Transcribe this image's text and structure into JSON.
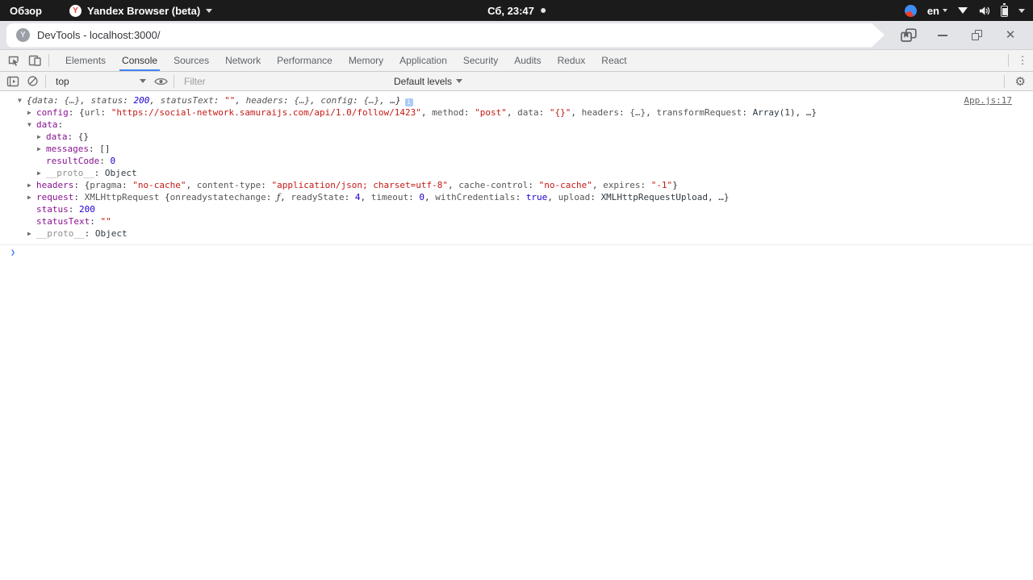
{
  "topbar": {
    "activities": "Обзор",
    "app_menu": "Yandex Browser (beta)",
    "clock": "Сб, 23:47",
    "keyboard_layout": "en"
  },
  "titlebar": {
    "title": "DevTools - localhost:3000/",
    "site_badge": "Y",
    "yandex_badge": "Y"
  },
  "devtools": {
    "tabs": [
      "Elements",
      "Console",
      "Sources",
      "Network",
      "Performance",
      "Memory",
      "Application",
      "Security",
      "Audits",
      "Redux",
      "React"
    ],
    "selected_tab": "Console",
    "console_toolbar": {
      "context": "top",
      "filter_placeholder": "Filter",
      "levels": "Default levels"
    }
  },
  "icons": {
    "gear": "⚙",
    "kebab": "⋮",
    "close": "✕",
    "info": "i"
  },
  "colors": {
    "accent_tab_underline": "#4285f4",
    "key_purple": "#881391",
    "number_blue": "#1c00cf",
    "string_red": "#c41a16",
    "topbar_bg": "#1b1b1b",
    "toolbar_bg": "#f3f3f3"
  },
  "console": {
    "prompt": "❯",
    "arrow_down": "▼",
    "arrow_right": "▶",
    "lines": [
      {
        "indent": 0,
        "arrow": "down",
        "italic": true,
        "info_icon": true,
        "link": "App.js:17",
        "tokens": [
          {
            "t": "plain",
            "v": "{"
          },
          {
            "t": "dim",
            "v": "data"
          },
          {
            "t": "plain",
            "v": ": "
          },
          {
            "t": "dim",
            "v": "{…}"
          },
          {
            "t": "plain",
            "v": ", "
          },
          {
            "t": "dim",
            "v": "status"
          },
          {
            "t": "plain",
            "v": ": "
          },
          {
            "t": "num",
            "v": "200"
          },
          {
            "t": "plain",
            "v": ", "
          },
          {
            "t": "dim",
            "v": "statusText"
          },
          {
            "t": "plain",
            "v": ": "
          },
          {
            "t": "str",
            "v": "\"\""
          },
          {
            "t": "plain",
            "v": ", "
          },
          {
            "t": "dim",
            "v": "headers"
          },
          {
            "t": "plain",
            "v": ": "
          },
          {
            "t": "dim",
            "v": "{…}"
          },
          {
            "t": "plain",
            "v": ", "
          },
          {
            "t": "dim",
            "v": "config"
          },
          {
            "t": "plain",
            "v": ": "
          },
          {
            "t": "dim",
            "v": "{…}"
          },
          {
            "t": "plain",
            "v": ", …}"
          }
        ]
      },
      {
        "indent": 1,
        "arrow": "right",
        "tokens": [
          {
            "t": "key",
            "v": "config"
          },
          {
            "t": "plain",
            "v": ": {"
          },
          {
            "t": "dim",
            "v": "url"
          },
          {
            "t": "plain",
            "v": ": "
          },
          {
            "t": "str",
            "v": "\"https://social-network.samuraijs.com/api/1.0/follow/1423\""
          },
          {
            "t": "plain",
            "v": ", "
          },
          {
            "t": "dim",
            "v": "method"
          },
          {
            "t": "plain",
            "v": ": "
          },
          {
            "t": "str",
            "v": "\"post\""
          },
          {
            "t": "plain",
            "v": ", "
          },
          {
            "t": "dim",
            "v": "data"
          },
          {
            "t": "plain",
            "v": ": "
          },
          {
            "t": "str",
            "v": "\"{}\""
          },
          {
            "t": "plain",
            "v": ", "
          },
          {
            "t": "dim",
            "v": "headers"
          },
          {
            "t": "plain",
            "v": ": "
          },
          {
            "t": "dim",
            "v": "{…}"
          },
          {
            "t": "plain",
            "v": ", "
          },
          {
            "t": "dim",
            "v": "transformRequest"
          },
          {
            "t": "plain",
            "v": ": "
          },
          {
            "t": "plain",
            "v": "Array(1)"
          },
          {
            "t": "plain",
            "v": ", …}"
          }
        ]
      },
      {
        "indent": 1,
        "arrow": "down",
        "tokens": [
          {
            "t": "key",
            "v": "data"
          },
          {
            "t": "plain",
            "v": ":"
          }
        ]
      },
      {
        "indent": 2,
        "arrow": "right",
        "tokens": [
          {
            "t": "key",
            "v": "data"
          },
          {
            "t": "plain",
            "v": ": {}"
          }
        ]
      },
      {
        "indent": 2,
        "arrow": "right",
        "tokens": [
          {
            "t": "key",
            "v": "messages"
          },
          {
            "t": "plain",
            "v": ": []"
          }
        ]
      },
      {
        "indent": 2,
        "arrow": null,
        "tokens": [
          {
            "t": "key",
            "v": "resultCode"
          },
          {
            "t": "plain",
            "v": ": "
          },
          {
            "t": "num",
            "v": "0"
          }
        ]
      },
      {
        "indent": 2,
        "arrow": "right",
        "tokens": [
          {
            "t": "proto",
            "v": "__proto__"
          },
          {
            "t": "plain",
            "v": ": "
          },
          {
            "t": "plain",
            "v": "Object"
          }
        ]
      },
      {
        "indent": 1,
        "arrow": "right",
        "tokens": [
          {
            "t": "key",
            "v": "headers"
          },
          {
            "t": "plain",
            "v": ": {"
          },
          {
            "t": "dim",
            "v": "pragma"
          },
          {
            "t": "plain",
            "v": ": "
          },
          {
            "t": "str",
            "v": "\"no-cache\""
          },
          {
            "t": "plain",
            "v": ", "
          },
          {
            "t": "dim",
            "v": "content-type"
          },
          {
            "t": "plain",
            "v": ": "
          },
          {
            "t": "str",
            "v": "\"application/json; charset=utf-8\""
          },
          {
            "t": "plain",
            "v": ", "
          },
          {
            "t": "dim",
            "v": "cache-control"
          },
          {
            "t": "plain",
            "v": ": "
          },
          {
            "t": "str",
            "v": "\"no-cache\""
          },
          {
            "t": "plain",
            "v": ", "
          },
          {
            "t": "dim",
            "v": "expires"
          },
          {
            "t": "plain",
            "v": ": "
          },
          {
            "t": "str",
            "v": "\"-1\""
          },
          {
            "t": "plain",
            "v": "}"
          }
        ]
      },
      {
        "indent": 1,
        "arrow": "right",
        "tokens": [
          {
            "t": "key",
            "v": "request"
          },
          {
            "t": "plain",
            "v": ": "
          },
          {
            "t": "dim",
            "v": "XMLHttpRequest "
          },
          {
            "t": "plain",
            "v": "{"
          },
          {
            "t": "dim",
            "v": "onreadystatechange"
          },
          {
            "t": "plain",
            "v": ": "
          },
          {
            "t": "fn",
            "v": "ƒ"
          },
          {
            "t": "plain",
            "v": ", "
          },
          {
            "t": "dim",
            "v": "readyState"
          },
          {
            "t": "plain",
            "v": ": "
          },
          {
            "t": "num",
            "v": "4"
          },
          {
            "t": "plain",
            "v": ", "
          },
          {
            "t": "dim",
            "v": "timeout"
          },
          {
            "t": "plain",
            "v": ": "
          },
          {
            "t": "num",
            "v": "0"
          },
          {
            "t": "plain",
            "v": ", "
          },
          {
            "t": "dim",
            "v": "withCredentials"
          },
          {
            "t": "plain",
            "v": ": "
          },
          {
            "t": "num",
            "v": "true"
          },
          {
            "t": "plain",
            "v": ", "
          },
          {
            "t": "dim",
            "v": "upload"
          },
          {
            "t": "plain",
            "v": ": "
          },
          {
            "t": "plain",
            "v": "XMLHttpRequestUpload"
          },
          {
            "t": "plain",
            "v": ", …}"
          }
        ]
      },
      {
        "indent": 1,
        "arrow": null,
        "tokens": [
          {
            "t": "key",
            "v": "status"
          },
          {
            "t": "plain",
            "v": ": "
          },
          {
            "t": "num",
            "v": "200"
          }
        ]
      },
      {
        "indent": 1,
        "arrow": null,
        "tokens": [
          {
            "t": "key",
            "v": "statusText"
          },
          {
            "t": "plain",
            "v": ": "
          },
          {
            "t": "str",
            "v": "\"\""
          }
        ]
      },
      {
        "indent": 1,
        "arrow": "right",
        "tokens": [
          {
            "t": "proto",
            "v": "__proto__"
          },
          {
            "t": "plain",
            "v": ": "
          },
          {
            "t": "plain",
            "v": "Object"
          }
        ]
      }
    ]
  }
}
